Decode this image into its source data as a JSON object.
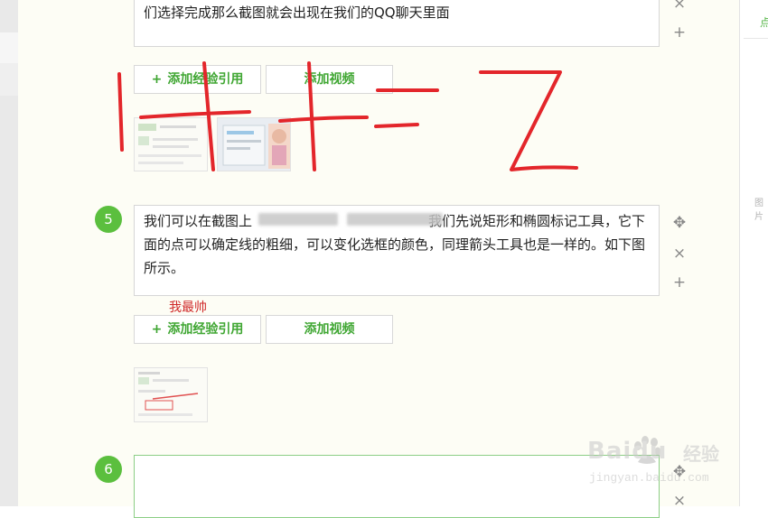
{
  "steps": [
    {
      "text": "们选择完成那么截图就会出现在我们的QQ聊天里面"
    },
    {
      "number": "5",
      "text": "我们可以在截图上　　　　　　　　　　　　　我们先说矩形和椭圆标记工具，它下面的点可以确定线的粗细，可以变化选框的颜色，同理箭头工具也是一样的。如下图所示。",
      "annotation": "我最帅"
    },
    {
      "number": "6",
      "text": ""
    }
  ],
  "buttons": {
    "plus": "+",
    "add_reference": "添加经验引用",
    "add_video": "添加视频"
  },
  "tools": {
    "move": "✥",
    "delete": "×",
    "add": "+"
  },
  "handwriting": "1+1=2",
  "right_panel": {
    "hint_top": "点",
    "hint_mid": "图片"
  },
  "watermark": {
    "brand": "Baidu",
    "brand_suffix": "经验",
    "url": "jingyan.baidu.com"
  }
}
